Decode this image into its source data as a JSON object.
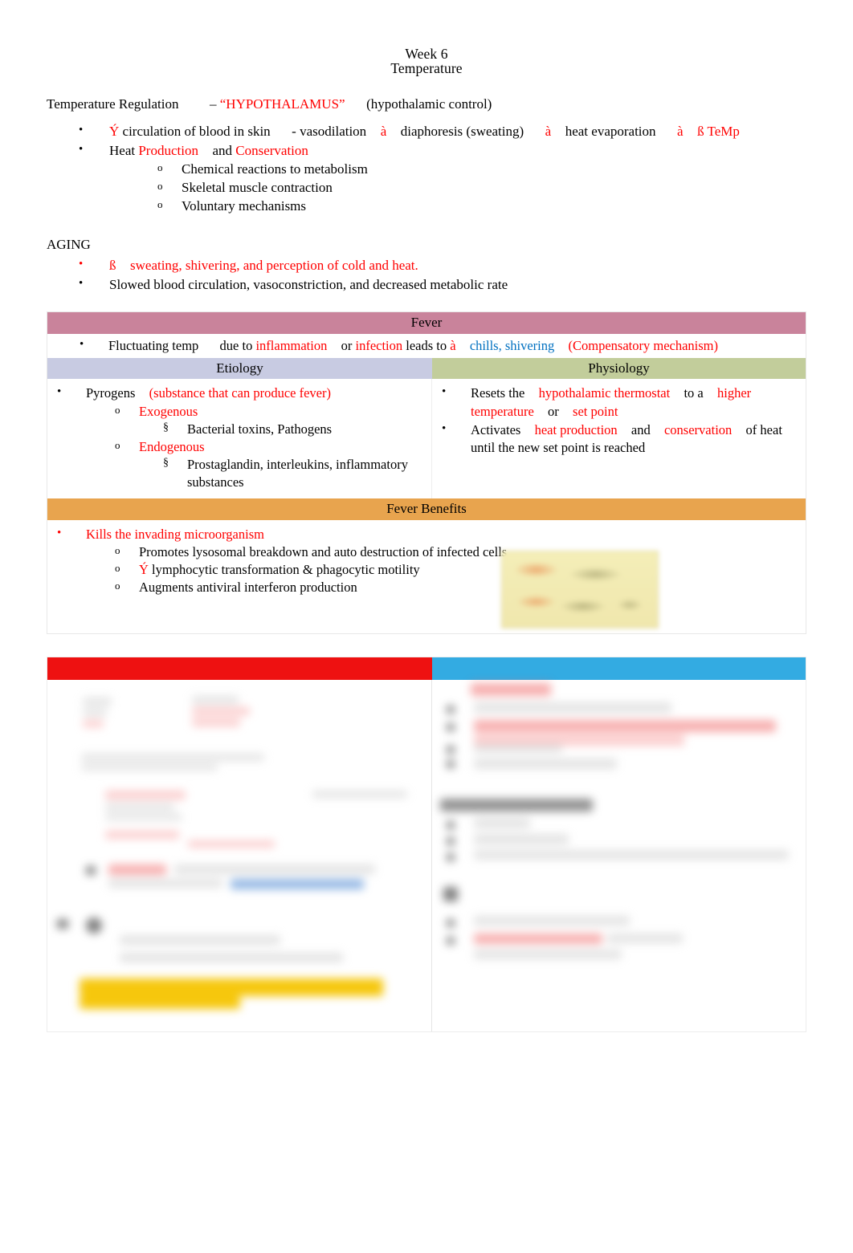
{
  "document": {
    "title_lines": [
      "Week 6",
      "Temperature"
    ]
  },
  "intro": {
    "label": "Temperature Regulation",
    "dash": "–",
    "hypothalamus": "“HYPOTHALAMUS”",
    "paren": "(hypothalamic control)"
  },
  "regulation_bullets": {
    "line1": {
      "arrow_up": "Ý",
      "t1": "circulation of blood in skin",
      "t2": "- vasodilation",
      "a1": "à",
      "t3": "diaphoresis (sweating)",
      "a2": "à",
      "t4": "heat evaporation",
      "a3": "à",
      "arrow_down": "ß",
      "t5": "TeMp"
    },
    "line2": {
      "heat": "Heat",
      "production": "Production",
      "and": "and",
      "conservation": "Conservation"
    },
    "sub": [
      "Chemical reactions to metabolism",
      "Skeletal muscle contraction",
      "Voluntary mechanisms"
    ]
  },
  "aging": {
    "heading": "AGING",
    "items": [
      {
        "arrow_down": "ß",
        "text": "sweating, shivering, and perception of cold and heat.",
        "color": "red"
      },
      {
        "arrow_down": "",
        "text": "Slowed blood circulation, vasoconstriction, and decreased metabolic rate",
        "color": "black"
      }
    ]
  },
  "fever_table": {
    "header": "Fever",
    "fluctuating": {
      "t1": "Fluctuating temp",
      "t2": "due to",
      "inflammation": "inflammation",
      "or": "or",
      "infection": "infection",
      "t3": "leads to",
      "arrow": "à",
      "chills": "chills, shivering",
      "compensatory": "(Compensatory mechanism)"
    },
    "col_headers": {
      "left": "Etiology",
      "right": "Physiology"
    },
    "etiology": {
      "pyrogens": "Pyrogens",
      "pyrogens_def": "(substance that can produce fever)",
      "exogenous": "Exogenous",
      "exogenous_sub": "Bacterial toxins, Pathogens",
      "endogenous": "Endogenous",
      "endogenous_sub": "Prostaglandin, interleukins, inflammatory substances"
    },
    "physiology": {
      "b1_pre": "Resets  the",
      "b1_thermostat": "hypothalamic thermostat",
      "b1_mid": "to a",
      "b1_higher": "higher temperature",
      "b1_or": "or",
      "b1_setpoint": "set point",
      "b2_pre": "Activates",
      "b2_heat": "heat production",
      "b2_and": "and",
      "b2_cons": "conservation",
      "b2_post": "of heat until the new set point is reached"
    },
    "benefits_header": "Fever Benefits",
    "benefits": {
      "main": "Kills the invading microorganism",
      "items": [
        {
          "arrow_up": "",
          "text": "Promotes lysosomal breakdown and auto destruction of infected cells"
        },
        {
          "arrow_up": "Ý",
          "text": "lymphocytic transformation & phagocytic motility"
        },
        {
          "arrow_up": "",
          "text": "Augments antiviral interferon production"
        }
      ]
    }
  },
  "redacted_table": {
    "note": "blurred / illegible content",
    "left_header_color": "#ee1111",
    "right_header_color": "#33abe2"
  },
  "colors": {
    "fever_band": "#c9839b",
    "etiology_band": "#c8cbe2",
    "physiology_band": "#c2cd9b",
    "benefits_band": "#e8a44e",
    "red_text": "#ff0000",
    "blue_text": "#0070c0",
    "highlight_yellow": "#f5c400"
  }
}
